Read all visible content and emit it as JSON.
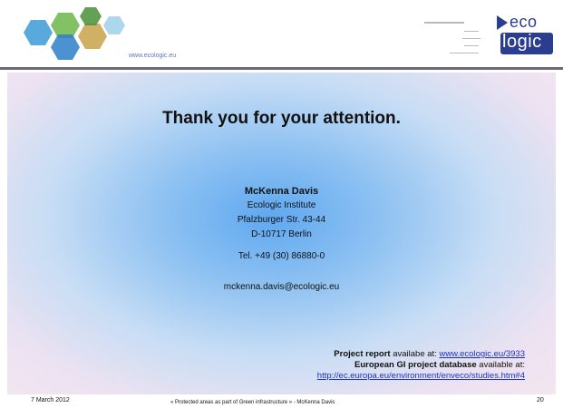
{
  "header": {
    "url": "www.ecologic.eu",
    "logo_top": "eco",
    "logo_bottom": "logic"
  },
  "main": {
    "title": "Thank you for your attention.",
    "contact": {
      "name": "McKenna Davis",
      "institution": "Ecologic Institute",
      "street": "Pfalzburger Str. 43-44",
      "city": "D-10717 Berlin",
      "phone": "Tel. +49 (30) 86880-0",
      "email": "mckenna.davis@ecologic.eu"
    },
    "references": {
      "report_label": "Project report",
      "report_text": " availabe at: ",
      "report_link": "www.ecologic.eu/3933",
      "db_label": "European GI project database",
      "db_text": " available at:",
      "db_link": "http://ec.europa.eu/environment/enveco/studies.htm#4"
    }
  },
  "footer": {
    "date": "7 March 2012",
    "caption": "« Protected areas as part of Green infrastructure » - McKenna Davis",
    "page": "20"
  },
  "colors": {
    "brand_blue": "#2b3d8f",
    "link": "#1a33cc",
    "rule": "#6a6a7a"
  }
}
